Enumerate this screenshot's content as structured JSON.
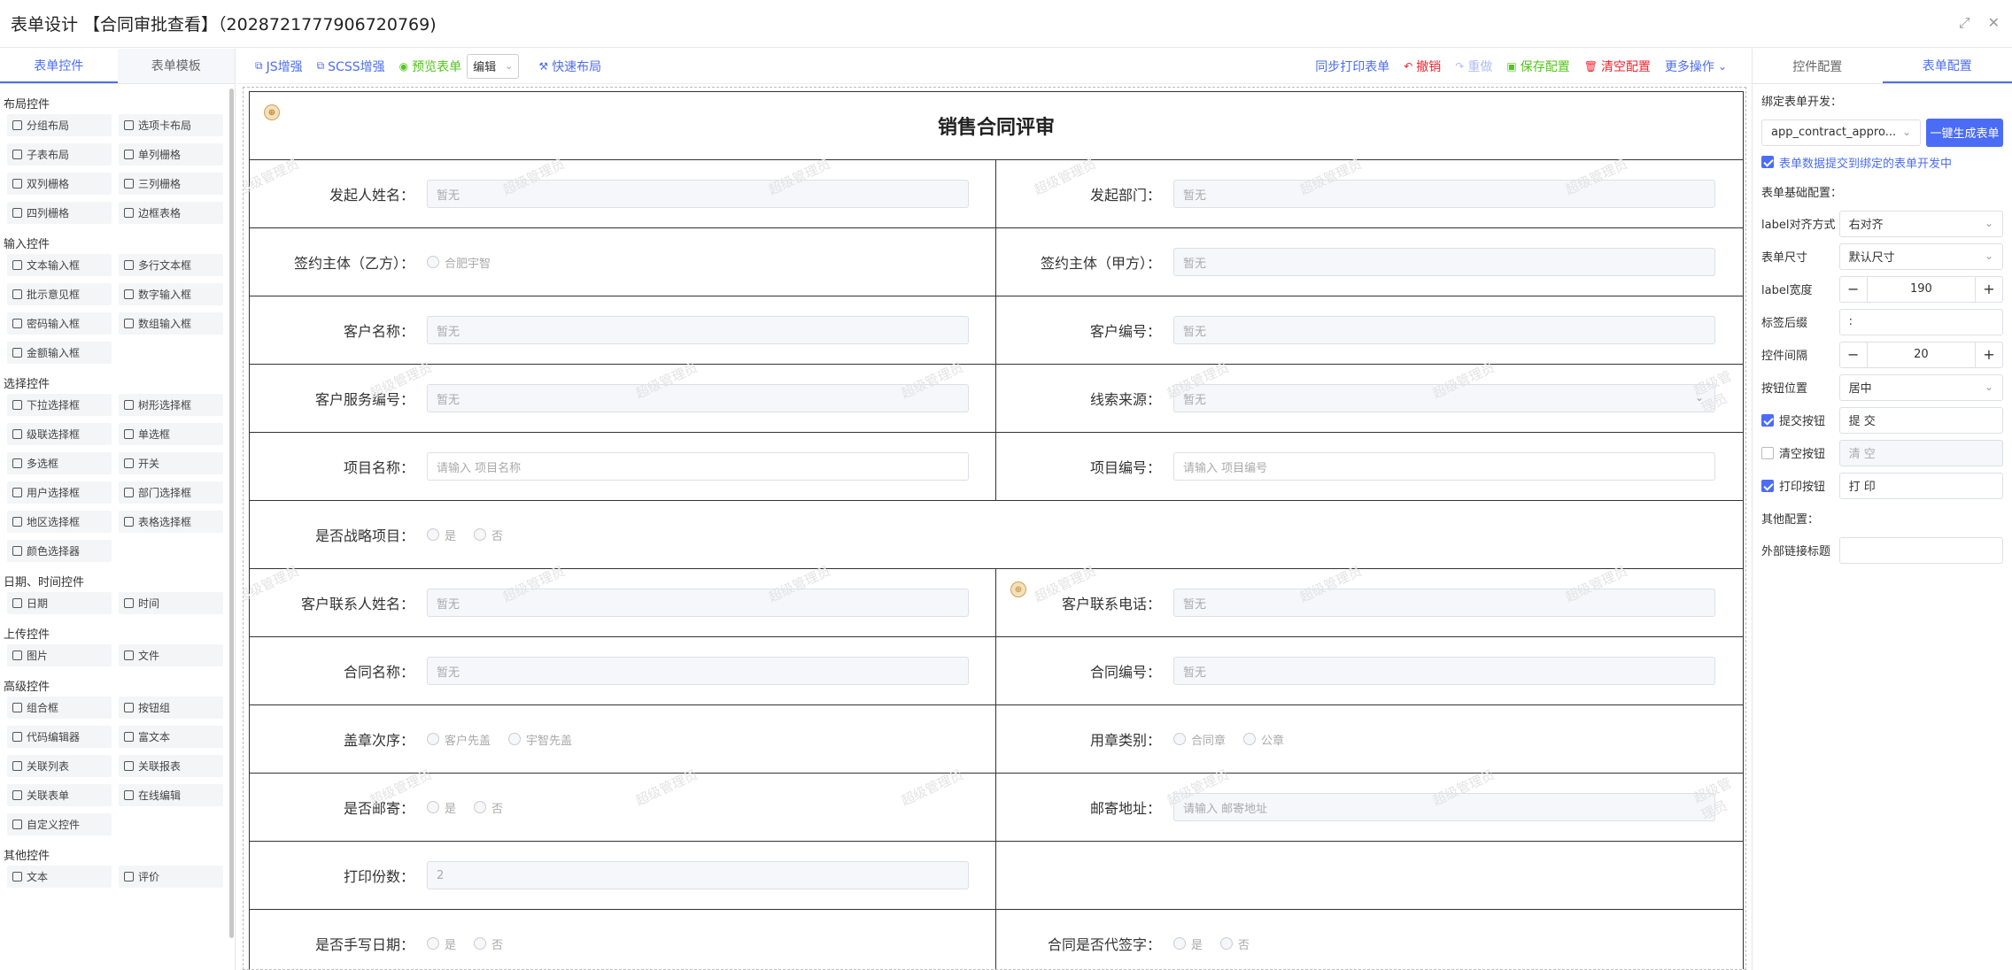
{
  "title": "表单设计 【合同审批查看】（2028721777906720769)",
  "left": {
    "tabs": [
      "表单控件",
      "表单模板"
    ],
    "groups": [
      {
        "name": "布局控件",
        "items": [
          "分组布局",
          "选项卡布局",
          "子表布局",
          "单列栅格",
          "双列栅格",
          "三列栅格",
          "四列栅格",
          "边框表格"
        ]
      },
      {
        "name": "输入控件",
        "items": [
          "文本输入框",
          "多行文本框",
          "批示意见框",
          "数字输入框",
          "密码输入框",
          "数组输入框",
          "金额输入框"
        ]
      },
      {
        "name": "选择控件",
        "items": [
          "下拉选择框",
          "树形选择框",
          "级联选择框",
          "单选框",
          "多选框",
          "开关",
          "用户选择框",
          "部门选择框",
          "地区选择框",
          "表格选择框",
          "颜色选择器"
        ]
      },
      {
        "name": "日期、时间控件",
        "items": [
          "日期",
          "时间"
        ]
      },
      {
        "name": "上传控件",
        "items": [
          "图片",
          "文件"
        ]
      },
      {
        "name": "高级控件",
        "items": [
          "组合框",
          "按钮组",
          "代码编辑器",
          "富文本",
          "关联列表",
          "关联报表",
          "关联表单",
          "在线编辑",
          "自定义控件"
        ]
      },
      {
        "name": "其他控件",
        "items": [
          "文本",
          "评价"
        ]
      }
    ]
  },
  "toolbar": {
    "js": "JS增强",
    "scss": "SCSS增强",
    "preview": "预览表单",
    "mode": "编辑",
    "quick_layout": "快速布局",
    "sync_print": "同步打印表单",
    "undo": "撤销",
    "redo": "重做",
    "save": "保存配置",
    "clear": "清空配置",
    "more": "更多操作"
  },
  "form": {
    "title": "销售合同评审",
    "watermark": "超级管理员",
    "empty": "暂无",
    "rows": [
      [
        {
          "label": "发起人姓名：",
          "type": "input",
          "value": "暂无"
        },
        {
          "label": "发起部门：",
          "type": "input",
          "value": "暂无"
        }
      ],
      [
        {
          "label": "签约主体（乙方）：",
          "type": "radio",
          "options": [
            "合肥宇智"
          ]
        },
        {
          "label": "签约主体（甲方）：",
          "type": "input",
          "value": "暂无"
        }
      ],
      [
        {
          "label": "客户名称：",
          "type": "input",
          "value": "暂无"
        },
        {
          "label": "客户编号：",
          "type": "input",
          "value": "暂无"
        }
      ],
      [
        {
          "label": "客户服务编号：",
          "type": "input",
          "value": "暂无"
        },
        {
          "label": "线索来源：",
          "type": "select",
          "value": "暂无"
        }
      ],
      [
        {
          "label": "项目名称：",
          "type": "inputw",
          "value": "请输入 项目名称"
        },
        {
          "label": "项目编号：",
          "type": "inputw",
          "value": "请输入 项目编号"
        }
      ],
      [
        {
          "label": "是否战略项目：",
          "type": "radio",
          "options": [
            "是",
            "否"
          ],
          "full": true
        }
      ],
      [
        {
          "label": "客户联系人姓名：",
          "type": "input",
          "value": "暂无"
        },
        {
          "label": "客户联系电话：",
          "type": "input",
          "value": "暂无"
        }
      ],
      [
        {
          "label": "合同名称：",
          "type": "input",
          "value": "暂无"
        },
        {
          "label": "合同编号：",
          "type": "input",
          "value": "暂无"
        }
      ],
      [
        {
          "label": "盖章次序：",
          "type": "radio",
          "options": [
            "客户先盖",
            "宇智先盖"
          ]
        },
        {
          "label": "用章类别：",
          "type": "radio",
          "options": [
            "合同章",
            "公章"
          ]
        }
      ],
      [
        {
          "label": "是否邮寄：",
          "type": "radio",
          "options": [
            "是",
            "否"
          ]
        },
        {
          "label": "邮寄地址：",
          "type": "input",
          "value": "请输入 邮寄地址"
        }
      ],
      [
        {
          "label": "打印份数：",
          "type": "input",
          "value": "2"
        },
        {
          "label": "",
          "type": "none"
        }
      ],
      [
        {
          "label": "是否手写日期：",
          "type": "radio",
          "options": [
            "是",
            "否"
          ]
        },
        {
          "label": "合同是否代签字：",
          "type": "radio",
          "options": [
            "是",
            "否"
          ]
        }
      ]
    ]
  },
  "right": {
    "tabs": [
      "控件配置",
      "表单配置"
    ],
    "bind_label": "绑定表单开发：",
    "bind_value": "app_contract_appro...",
    "gen_button": "一键生成表单",
    "submit_bind": "表单数据提交到绑定的表单开发中",
    "basic_title": "表单基础配置：",
    "label_align_k": "label对齐方式",
    "label_align_v": "右对齐",
    "size_k": "表单尺寸",
    "size_v": "默认尺寸",
    "label_width_k": "label宽度",
    "label_width_v": "190",
    "suffix_k": "标签后缀",
    "suffix_v": ":",
    "gap_k": "控件间隔",
    "gap_v": "20",
    "btn_pos_k": "按钮位置",
    "btn_pos_v": "居中",
    "submit_k": "提交按钮",
    "submit_v": "提 交",
    "clear_k": "清空按钮",
    "clear_v": "清 空",
    "print_k": "打印按钮",
    "print_v": "打 印",
    "other_title": "其他配置：",
    "ext_k": "外部链接标题",
    "ext_v": ""
  }
}
